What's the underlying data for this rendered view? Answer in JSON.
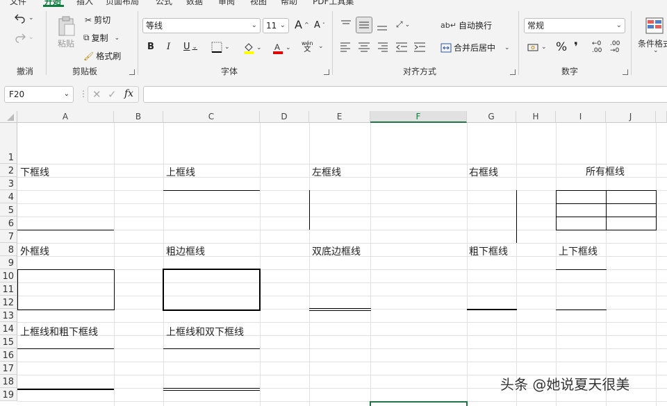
{
  "ribbon_tabs": [
    "文件",
    "开始",
    "插入",
    "页面布局",
    "公式",
    "数据",
    "审阅",
    "视图",
    "帮助",
    "PDF工具集"
  ],
  "undo_group": {
    "label": "撤消"
  },
  "clipboard": {
    "paste": "粘贴",
    "cut": "剪切",
    "copy": "复制",
    "format_painter": "格式刷",
    "label": "剪贴板"
  },
  "font": {
    "name": "等线",
    "size": "11",
    "grow": "A",
    "shrink": "A",
    "bold": "B",
    "italic": "I",
    "underline": "U",
    "label": "字体",
    "pinyin": "wén",
    "pinyin2": "文"
  },
  "alignment": {
    "wrap_text": "自动换行",
    "merge_center": "合并后居中",
    "label": "对齐方式"
  },
  "number": {
    "format": "常规",
    "percent": "%",
    "comma": "❜",
    "label": "数字"
  },
  "styles": {
    "conditional": "条件格式"
  },
  "formula_bar": {
    "name_box": "F20",
    "fx": "fx"
  },
  "columns": [
    "A",
    "B",
    "C",
    "D",
    "E",
    "F",
    "G",
    "H",
    "I",
    "J"
  ],
  "rows": [
    "1",
    "2",
    "3",
    "4",
    "5",
    "6",
    "7",
    "8",
    "9",
    "10",
    "11",
    "12",
    "13",
    "14",
    "15",
    "16",
    "17",
    "18",
    "19"
  ],
  "cells": {
    "A2": "下框线",
    "C2": "上框线",
    "E2": "左框线",
    "G2": "右框线",
    "IJ2": "所有框线",
    "A8": "外框线",
    "C8": "粗边框线",
    "E8": "双底边框线",
    "G8": "粗下框线",
    "I8": "上下框线",
    "A14": "上框线和粗下框线",
    "C14": "上框线和双下框线"
  },
  "watermark": "头条 @她说夏天很美"
}
